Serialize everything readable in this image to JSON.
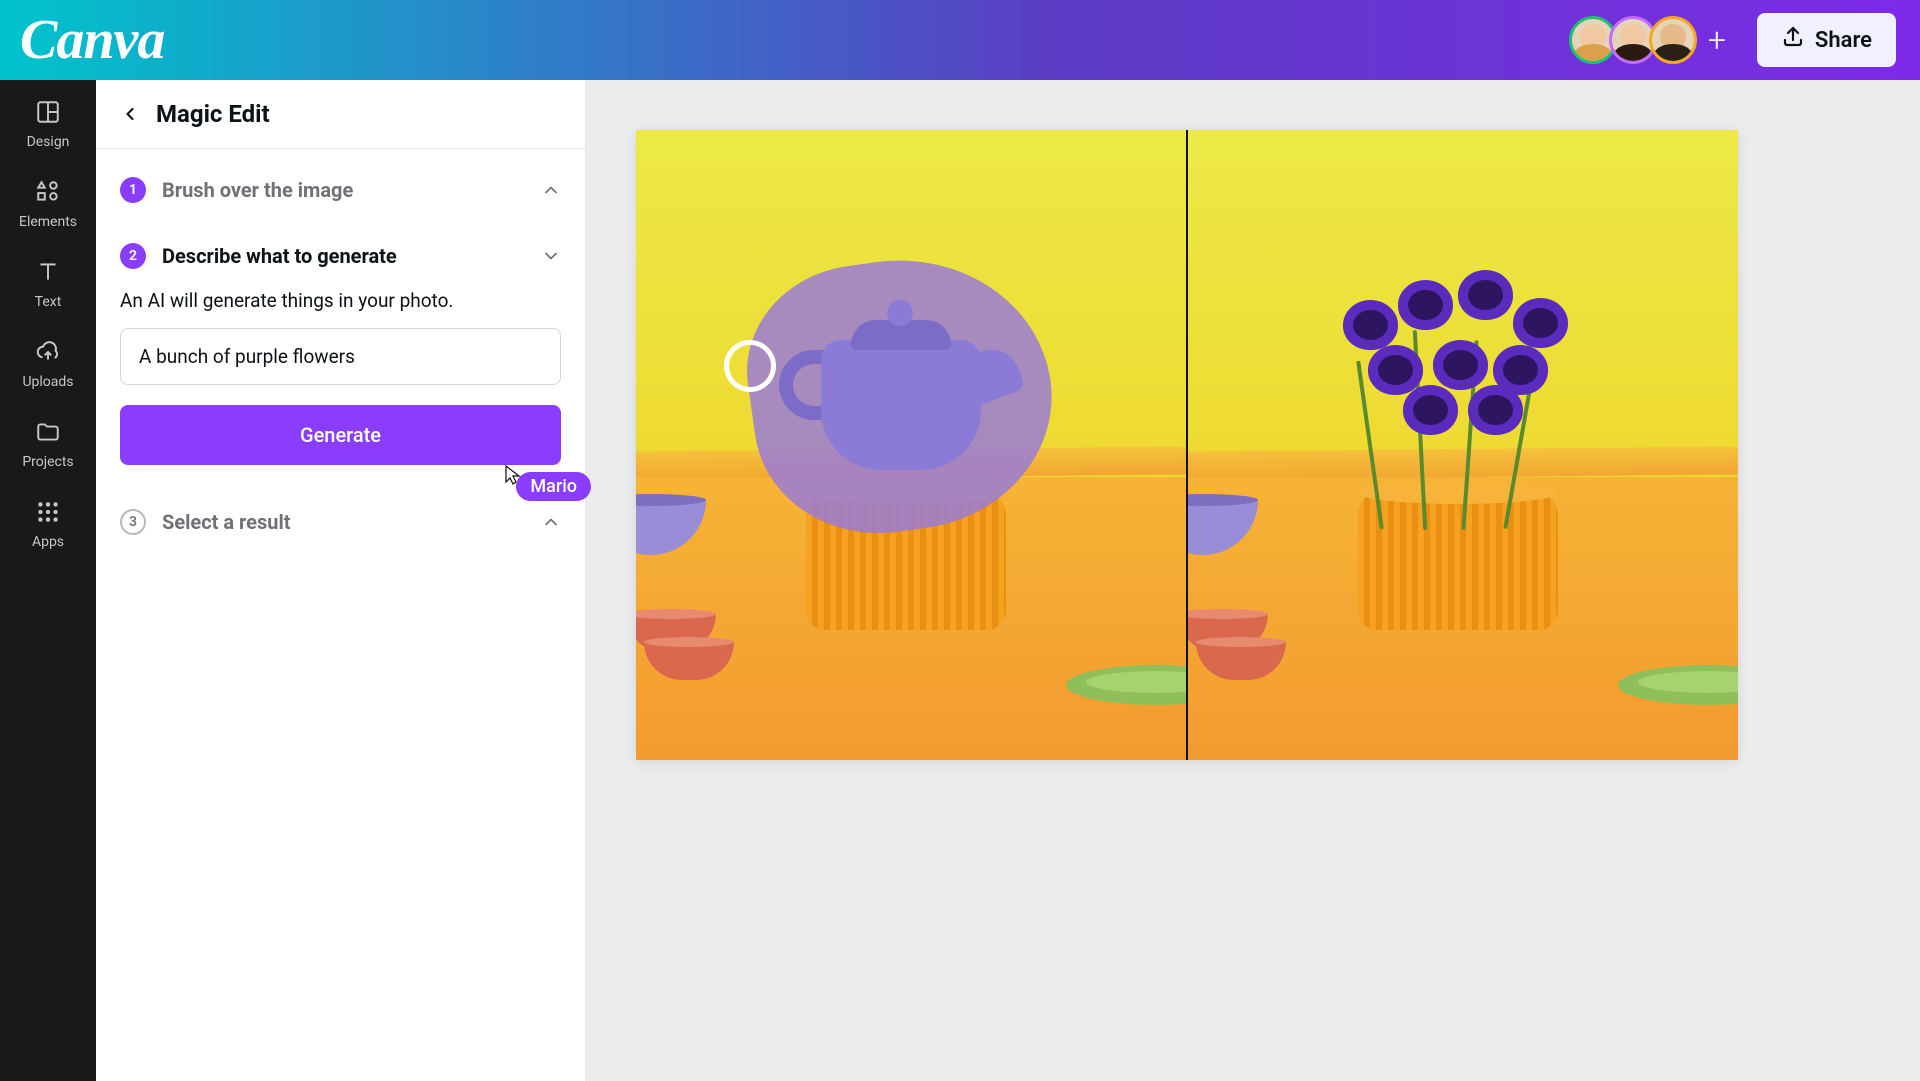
{
  "brand": "Canva",
  "header": {
    "share_label": "Share",
    "collaborators": [
      {
        "border": "#1fbf75",
        "skin": "#f2c8a0",
        "hair": "#d9a24a"
      },
      {
        "border": "#c56bff",
        "skin": "#f0c8a2",
        "hair": "#2b1a12"
      },
      {
        "border": "#f5a623",
        "skin": "#e6b98a",
        "hair": "#2a2016"
      }
    ]
  },
  "nav": [
    {
      "key": "design",
      "label": "Design"
    },
    {
      "key": "elements",
      "label": "Elements"
    },
    {
      "key": "text",
      "label": "Text"
    },
    {
      "key": "uploads",
      "label": "Uploads"
    },
    {
      "key": "projects",
      "label": "Projects"
    },
    {
      "key": "apps",
      "label": "Apps"
    }
  ],
  "panel": {
    "title": "Magic Edit",
    "steps": {
      "s1": {
        "num": "1",
        "title": "Brush over the image"
      },
      "s2": {
        "num": "2",
        "title": "Describe what to generate",
        "desc": "An AI will generate things in your photo.",
        "prompt_value": "A bunch of purple flowers",
        "generate_label": "Generate"
      },
      "s3": {
        "num": "3",
        "title": "Select a result"
      }
    }
  },
  "cursor_user": "Mario",
  "colors": {
    "accent": "#8b3dff"
  }
}
